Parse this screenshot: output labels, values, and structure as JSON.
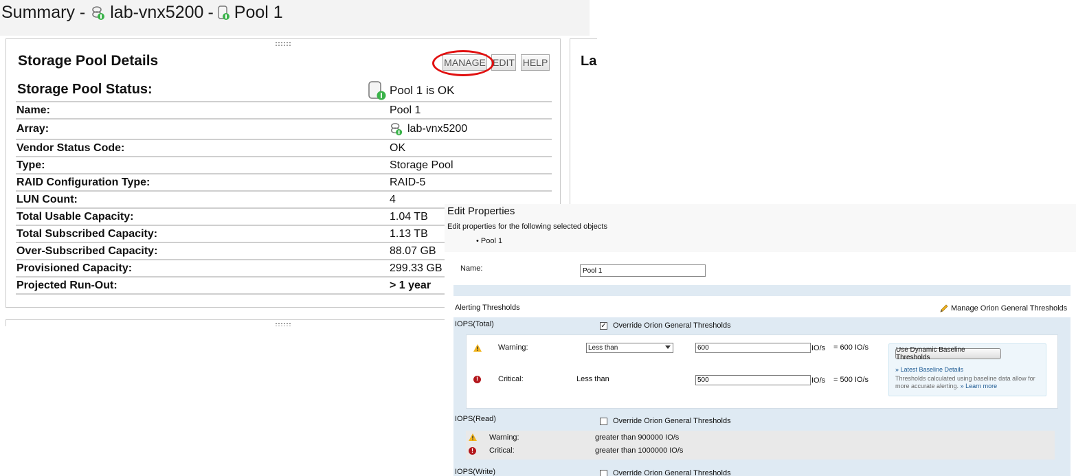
{
  "summary": {
    "title_prefix": "Summary -",
    "title_array": "lab-vnx5200",
    "title_sep": "-",
    "title_pool": "Pool 1"
  },
  "details": {
    "title": "Storage Pool Details",
    "buttons": {
      "manage": "MANAGE",
      "edit": "EDIT",
      "help": "HELP"
    },
    "status_label": "Storage Pool Status:",
    "status_value": "Pool 1 is OK",
    "rows": [
      {
        "key": "Name:",
        "value": "Pool 1"
      },
      {
        "key": "Array:",
        "value": "lab-vnx5200",
        "icon": "array-icon"
      },
      {
        "key": "Vendor Status Code:",
        "value": "OK"
      },
      {
        "key": "Type:",
        "value": "Storage Pool"
      },
      {
        "key": "RAID Configuration Type:",
        "value": "RAID-5"
      },
      {
        "key": "LUN Count:",
        "value": "4"
      },
      {
        "key": "Total Usable Capacity:",
        "value": "1.04 TB"
      },
      {
        "key": "Total Subscribed Capacity:",
        "value": "1.13 TB"
      },
      {
        "key": "Over-Subscribed Capacity:",
        "value": "88.07 GB"
      },
      {
        "key": "Provisioned Capacity:",
        "value": "299.33 GB"
      },
      {
        "key": "Projected Run-Out:",
        "value": "> 1 year",
        "bold": true
      }
    ]
  },
  "side_panel": {
    "label": "La"
  },
  "edit_properties": {
    "title": "Edit Properties",
    "subtitle": "Edit properties for the following selected objects",
    "selected_object": "• Pool 1",
    "name_label": "Name:",
    "name_value": "Pool 1",
    "alerting_heading": "Alerting Thresholds",
    "manage_thresholds_link": "Manage Orion General Thresholds",
    "override_label": "Override Orion General Thresholds",
    "iops_total": {
      "title": "IOPS(Total)",
      "override_checked": true,
      "warning_label": "Warning:",
      "warning_operator": "Less than",
      "warning_value": "600",
      "warning_unit": "IO/s",
      "warning_result": "= 600 IO/s",
      "critical_label": "Critical:",
      "critical_operator": "Less than",
      "critical_value": "500",
      "critical_unit": "IO/s",
      "critical_result": "= 500 IO/s"
    },
    "baseline": {
      "button": "Use Dynamic Baseline Thresholds",
      "link": "» Latest Baseline Details",
      "note": "Thresholds calculated using baseline data allow for more accurate alerting.",
      "learn_more": "» Learn more"
    },
    "iops_read": {
      "title": "IOPS(Read)",
      "override_checked": false,
      "warning_label": "Warning:",
      "warning_text": "greater than 900000 IO/s",
      "critical_label": "Critical:",
      "critical_text": "greater than 1000000 IO/s"
    },
    "iops_write": {
      "title": "IOPS(Write)",
      "override_checked": false
    }
  },
  "colors": {
    "highlight_circle": "#e11010",
    "status_ok": "#3bb34a",
    "section_blue": "#dfeaf3",
    "link_blue": "#1d5a93",
    "critical_red": "#b3171c",
    "warning_yellow": "#f2b41c"
  }
}
